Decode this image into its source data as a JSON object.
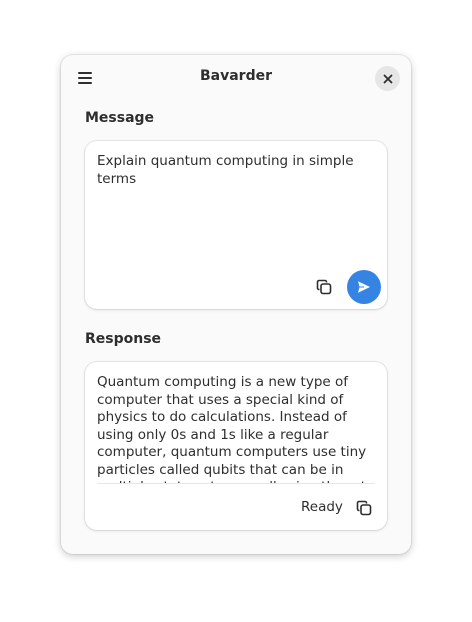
{
  "window": {
    "title": "Bavarder"
  },
  "message": {
    "label": "Message",
    "text": "Explain quantum computing in simple terms"
  },
  "response": {
    "label": "Response",
    "text": "Quantum computing is a new type of computer that uses a special kind of physics to do calculations. Instead of using only 0s and 1s like a regular computer, quantum computers use tiny particles called qubits that can be in multiple states at once, allowing them to process many possibilities simultaneously.",
    "status": "Ready"
  },
  "icons": {
    "menu": "hamburger-menu-icon",
    "close": "close-icon",
    "copy": "copy-icon",
    "send": "send-icon"
  },
  "colors": {
    "accent": "#3584e4",
    "window_bg": "#fafafa",
    "card_bg": "#ffffff",
    "text": "#2e2e2e"
  }
}
